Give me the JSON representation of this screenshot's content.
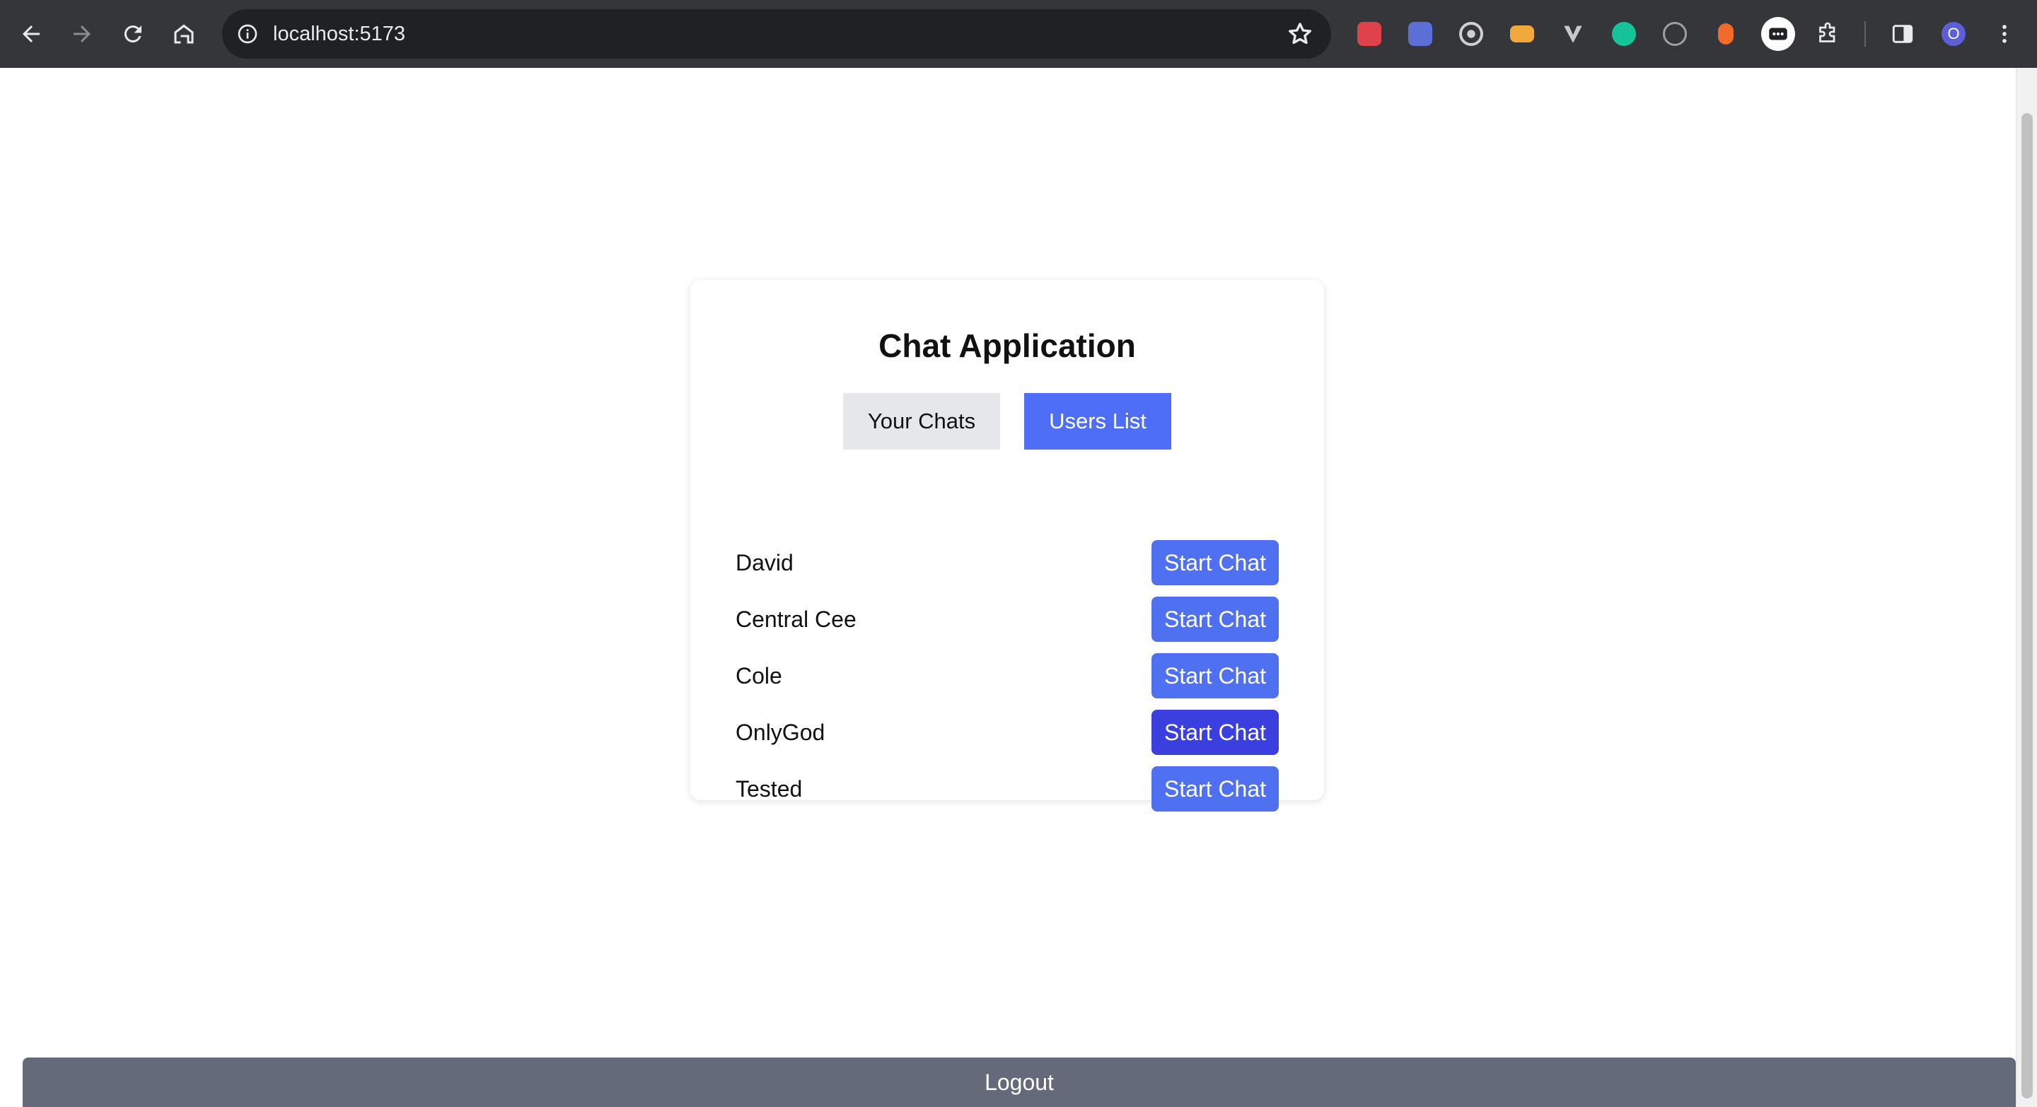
{
  "browser": {
    "url": "localhost:5173",
    "profile_initial": "O",
    "extensions": [
      {
        "name": "ext-red-icon",
        "color": "#e0424b"
      },
      {
        "name": "ext-download-icon",
        "color": "#5b6fd6"
      },
      {
        "name": "ext-target-icon",
        "color": "#d0d0d0"
      },
      {
        "name": "ext-ticket-icon",
        "color": "#f2a93b"
      },
      {
        "name": "ext-v-icon",
        "color": "#c8c8c8"
      },
      {
        "name": "ext-grammarly-icon",
        "color": "#15c39a"
      },
      {
        "name": "ext-info-icon",
        "color": "#9aa0a6"
      },
      {
        "name": "ext-orange-icon",
        "color": "#f26b2b"
      },
      {
        "name": "ext-chat-icon",
        "color": "#ffffff"
      },
      {
        "name": "ext-puzzle-icon",
        "color": "#c8c8c8"
      }
    ]
  },
  "app": {
    "title": "Chat Application",
    "tabs": [
      {
        "label": "Your Chats",
        "active": false
      },
      {
        "label": "Users List",
        "active": true
      }
    ],
    "users": [
      {
        "name": "David",
        "button": "Start Chat"
      },
      {
        "name": "Central Cee",
        "button": "Start Chat"
      },
      {
        "name": "Cole",
        "button": "Start Chat"
      },
      {
        "name": "OnlyGod",
        "button": "Start Chat",
        "hover": true
      },
      {
        "name": "Tested",
        "button": "Start Chat"
      }
    ],
    "logout_label": "Logout"
  },
  "colors": {
    "accent": "#4f6ef7",
    "button_hover": "#3b3fe0",
    "logout": "#646a79",
    "toolbar": "#35363a"
  }
}
